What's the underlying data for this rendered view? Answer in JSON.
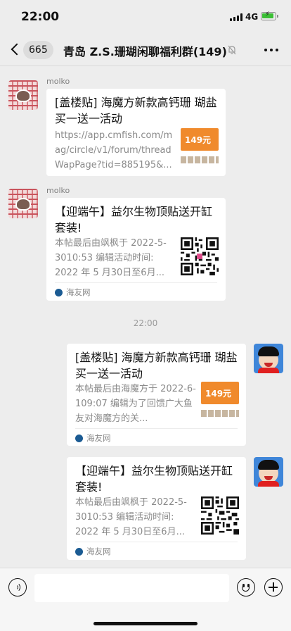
{
  "status_bar": {
    "time": "22:00",
    "network": "4G"
  },
  "nav": {
    "back_count": "665",
    "title": "青岛 Z.S.珊瑚闲聊福利群(149)"
  },
  "messages": [
    {
      "sender": "molko",
      "title": "[盖楼贴] 海魔方新款高钙珊 瑚盐买一送一活动",
      "desc": "https://app.cmfish.com/mag/circle/v1/forum/threadWapPage?tid=885195&...",
      "thumb_price": "149元"
    },
    {
      "sender": "molko",
      "title": "【迎端午】益尔生物顶贴送开缸套装!",
      "desc": "本帖最后由飒枫于 2022-5-3010:53 编辑活动时间: 2022 年 5 月30日至6月...",
      "source": "海友网"
    },
    {
      "title": "[盖楼贴] 海魔方新款高钙珊 瑚盐买一送一活动",
      "desc": "本帖最后由海魔方于 2022-6-109:07 编辑为了回馈广大鱼友对海魔方的关...",
      "thumb_price": "149元",
      "source": "海友网"
    },
    {
      "title": "【迎端午】益尔生物顶贴送开缸套装!",
      "desc": "本帖最后由飒枫于 2022-5-3010:53 编辑活动时间: 2022 年 5 月30日至6月...",
      "source": "海友网"
    }
  ],
  "time_divider": "22:00",
  "icons": [
    "back-icon",
    "mute-icon",
    "more-icon",
    "voice-icon",
    "emoji-icon",
    "plus-icon"
  ],
  "colors": {
    "background": "#ededed",
    "card": "#ffffff",
    "promo_orange": "#f08a2c",
    "avatar_blue": "#3f86d9"
  }
}
